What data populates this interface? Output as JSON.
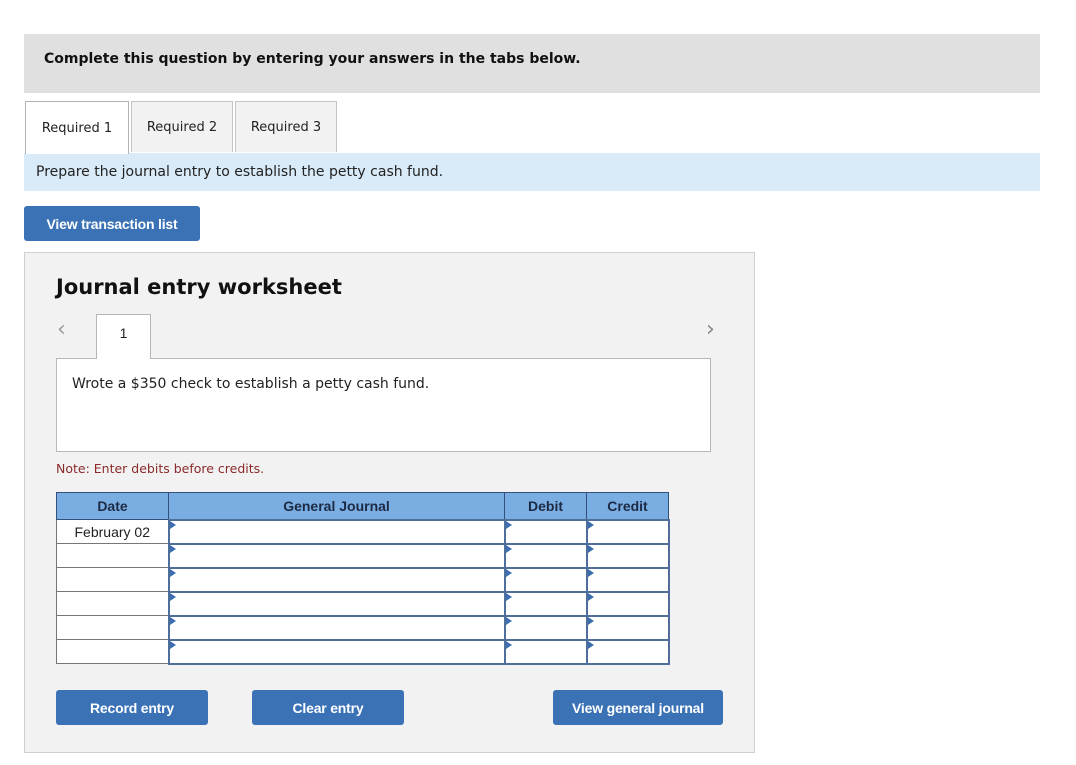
{
  "instructions": "Complete this question by entering your answers in the tabs below.",
  "tabs": [
    {
      "label": "Required 1",
      "active": true
    },
    {
      "label": "Required 2",
      "active": false
    },
    {
      "label": "Required 3",
      "active": false
    }
  ],
  "prompt": "Prepare the journal entry to establish the petty cash fund.",
  "view_transaction_list_label": "View transaction list",
  "worksheet": {
    "title": "Journal entry worksheet",
    "nav_prev_icon": "chevron-left-icon",
    "nav_next_icon": "chevron-right-icon",
    "entry_tabs": [
      "1"
    ],
    "description": "Wrote a $350 check to establish a petty cash fund.",
    "note": "Note: Enter debits before credits.",
    "columns": [
      "Date",
      "General Journal",
      "Debit",
      "Credit"
    ],
    "rows": [
      {
        "date": "February 02",
        "account": "",
        "debit": "",
        "credit": ""
      },
      {
        "date": "",
        "account": "",
        "debit": "",
        "credit": ""
      },
      {
        "date": "",
        "account": "",
        "debit": "",
        "credit": ""
      },
      {
        "date": "",
        "account": "",
        "debit": "",
        "credit": ""
      },
      {
        "date": "",
        "account": "",
        "debit": "",
        "credit": ""
      },
      {
        "date": "",
        "account": "",
        "debit": "",
        "credit": ""
      }
    ],
    "buttons": {
      "record": "Record entry",
      "clear": "Clear entry",
      "view_general_journal": "View general journal"
    }
  },
  "colors": {
    "button": "#3a72b5",
    "table_header": "#7aaee3",
    "prompt_bg": "#d9ebf8",
    "note_text": "#8b2a2a"
  }
}
